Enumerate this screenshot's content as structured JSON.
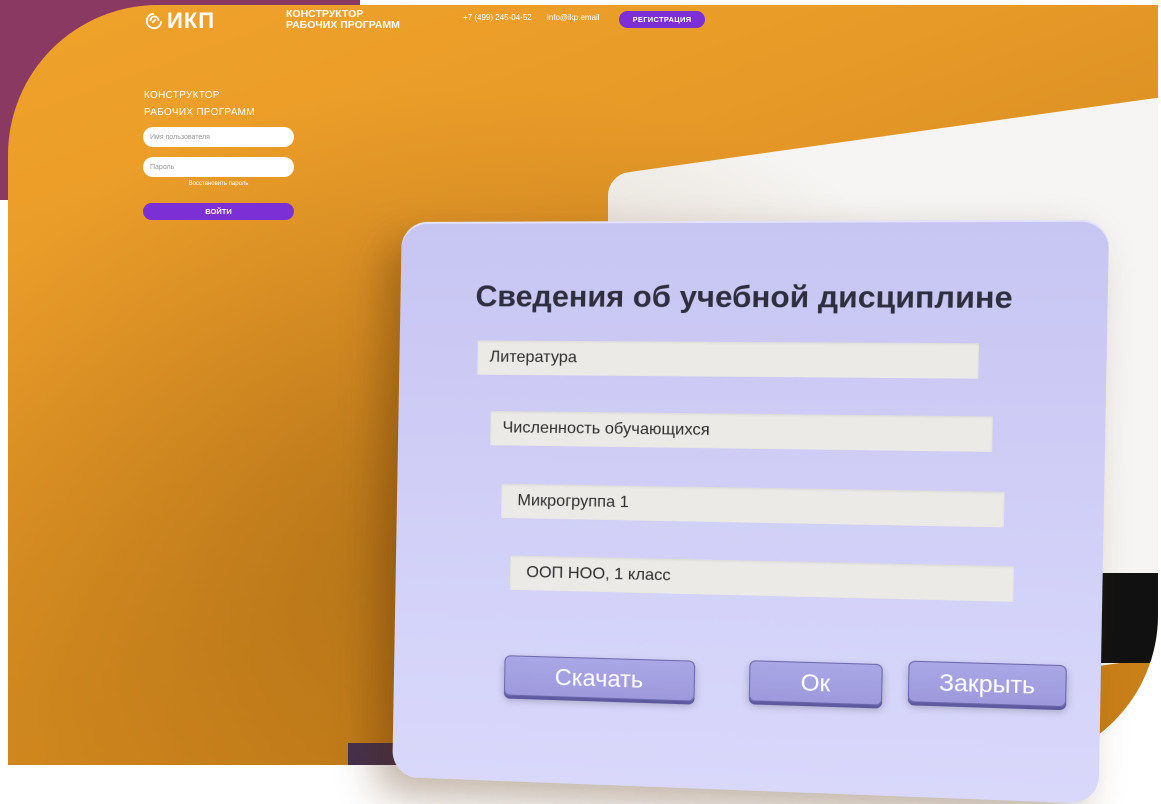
{
  "header": {
    "logo_text": "ИКП",
    "title_line1": "КОНСТРУКТОР",
    "title_line2": "РАБОЧИХ ПРОГРАММ",
    "phone": "+7 (499) 245-04-52",
    "email": "info@ikp.email",
    "register_label": "РЕГИСТРАЦИЯ"
  },
  "login": {
    "title_line1": "КОНСТРУКТОР",
    "title_line2": "РАБОЧИХ ПРОГРАММ",
    "username_placeholder": "Имя пользователя",
    "password_placeholder": "Пароль",
    "restore_label": "Восстановить пароль",
    "submit_label": "ВОЙТИ"
  },
  "dialog": {
    "title": "Сведения об учебной дисциплине",
    "fields": [
      "Литература",
      "Численность обучающихся",
      "Микрогруппа 1",
      "ООП НОО, 1 класс"
    ],
    "buttons": {
      "download": "Скачать",
      "ok": "Ок",
      "close": "Закрыть"
    }
  },
  "colors": {
    "accent": "#7d2fd6",
    "hero": "#e89a28",
    "corner": "#8a3a62",
    "card": "#cfcdf6"
  }
}
